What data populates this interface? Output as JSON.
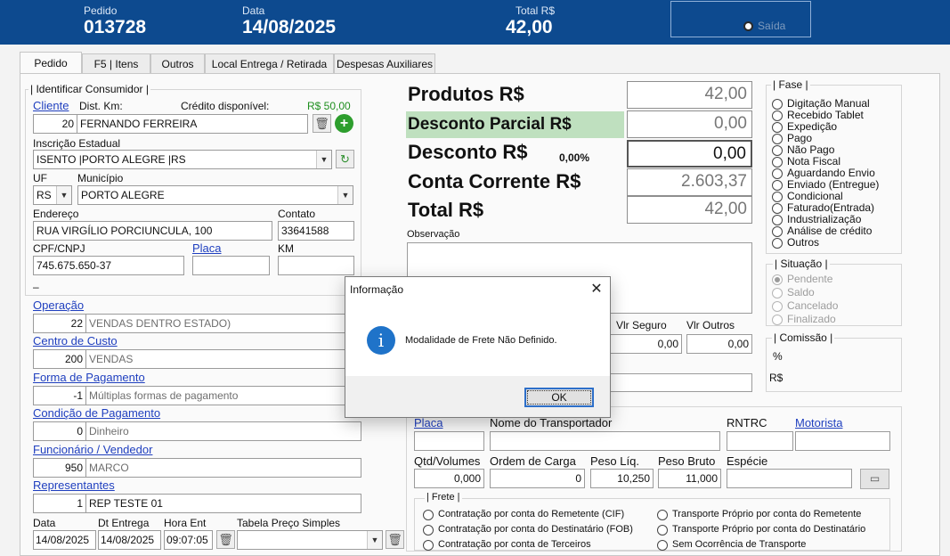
{
  "header": {
    "pedido_label": "Pedido",
    "pedido_value": "013728",
    "data_label": "Data",
    "data_value": "14/08/2025",
    "total_label": "Total R$",
    "total_value": "42,00",
    "saida_label": "Saída"
  },
  "tabs": [
    "Pedido",
    "F5 | Itens",
    "Outros",
    "Local Entrega  / Retirada",
    "Despesas Auxiliares"
  ],
  "consumidor": {
    "group_title": "| Identificar Consumidor |",
    "cliente_label": "Cliente",
    "dist_label": "Dist. Km:",
    "credito_label": "Crédito disponível:",
    "credito_value": "R$ 50,00",
    "cliente_code": "20",
    "cliente_name": "FERNANDO FERREIRA",
    "ie_label": "Inscrição Estadual",
    "ie_value": "ISENTO  |PORTO ALEGRE  |RS",
    "uf_label": "UF",
    "municipio_label": "Município",
    "uf_value": "RS",
    "municipio_value": "PORTO ALEGRE",
    "endereco_label": "Endereço",
    "contato_label": "Contato",
    "endereco_value": "RUA VIRGÍLIO PORCIUNCULA, 100",
    "contato_value": "33641588",
    "cpf_label": "CPF/CNPJ",
    "placa_label": "Placa",
    "km_label": "KM",
    "cpf_value": "745.675.650-37",
    "dash": "–"
  },
  "fields": [
    {
      "label": "Operação",
      "code": "22",
      "desc": "VENDAS DENTRO ESTADO)"
    },
    {
      "label": "Centro de Custo",
      "code": "200",
      "desc": "VENDAS"
    },
    {
      "label": "Forma de Pagamento",
      "code": "-1",
      "desc": "Múltiplas formas de pagamento"
    },
    {
      "label": "Condição de Pagamento",
      "code": "0",
      "desc": "Dinheiro"
    },
    {
      "label": "Funcionário / Vendedor",
      "code": "950",
      "desc": "MARCO"
    },
    {
      "label": "Representantes",
      "code": "1",
      "desc": "REP TESTE 01"
    }
  ],
  "bottom_row": {
    "data_label": "Data",
    "dt_entrega_label": "Dt Entrega",
    "hora_label": "Hora Ent",
    "tabela_label": "Tabela Preço Simples",
    "data_value": "14/08/2025",
    "dt_entrega_value": "14/08/2025",
    "hora_value": "09:07:05"
  },
  "totals": {
    "produtos_label": "Produtos R$",
    "produtos_value": "42,00",
    "desc_parcial_label": "Desconto Parcial R$",
    "desc_parcial_value": "0,00",
    "desconto_label": "Desconto R$",
    "desconto_pct": "0,00%",
    "desconto_value": "0,00",
    "conta_label": "Conta Corrente R$",
    "conta_value": "2.603,37",
    "total_label": "Total R$",
    "total_value": "42,00"
  },
  "observacao_label": "Observação",
  "despesas": {
    "seguro_label": "Vlr Seguro",
    "outros_label": "Vlr Outros",
    "seguro_value": "0,00",
    "outros_value": "0,00"
  },
  "fase": {
    "title": "| Fase |",
    "items": [
      "Digitação Manual",
      "Recebido Tablet",
      "Expedição",
      "Pago",
      "Não Pago",
      "Nota Fiscal",
      "Aguardando Envio",
      "Enviado (Entregue)",
      "Condicional",
      "Faturado(Entrada)",
      "Industrialização",
      "Análise de crédito",
      "Outros"
    ]
  },
  "situacao": {
    "title": "| Situação |",
    "items": [
      "Pendente",
      "Saldo",
      "Cancelado",
      "Finalizado"
    ],
    "selected": 0
  },
  "comissao": {
    "title": "| Comissão |",
    "pct": "%",
    "rs": "R$"
  },
  "transporte": {
    "placa_label": "Placa",
    "transportador_label": "Nome do Transportador",
    "rntrc_label": "RNTRC",
    "motorista_label": "Motorista",
    "qtd_label": "Qtd/Volumes",
    "ordem_label": "Ordem de Carga",
    "peso_liq_label": "Peso Líq.",
    "peso_bruto_label": "Peso Bruto",
    "especie_label": "Espécie",
    "qtd_value": "0,000",
    "ordem_value": "0",
    "peso_liq_value": "10,250",
    "peso_bruto_value": "11,000"
  },
  "frete": {
    "title": "| Frete |",
    "options": [
      "Contratação por conta do Remetente (CIF)",
      "Contratação por conta do Destinatário (FOB)",
      "Contratação por conta de Terceiros",
      "Transporte Próprio por conta do Remetente",
      "Transporte Próprio por conta do Destinatário",
      "Sem Ocorrência de Transporte"
    ]
  },
  "dialog": {
    "title": "Informação",
    "message": "Modalidade de Frete Não Definido.",
    "ok_label": "OK",
    "close_glyph": "✕",
    "icon_glyph": "i"
  },
  "colors": {
    "header": "#0d4a8f",
    "link": "#1f3fbf",
    "credit": "#1f8f1f",
    "highlight": "#bfe0bf",
    "info": "#1f73c9"
  }
}
